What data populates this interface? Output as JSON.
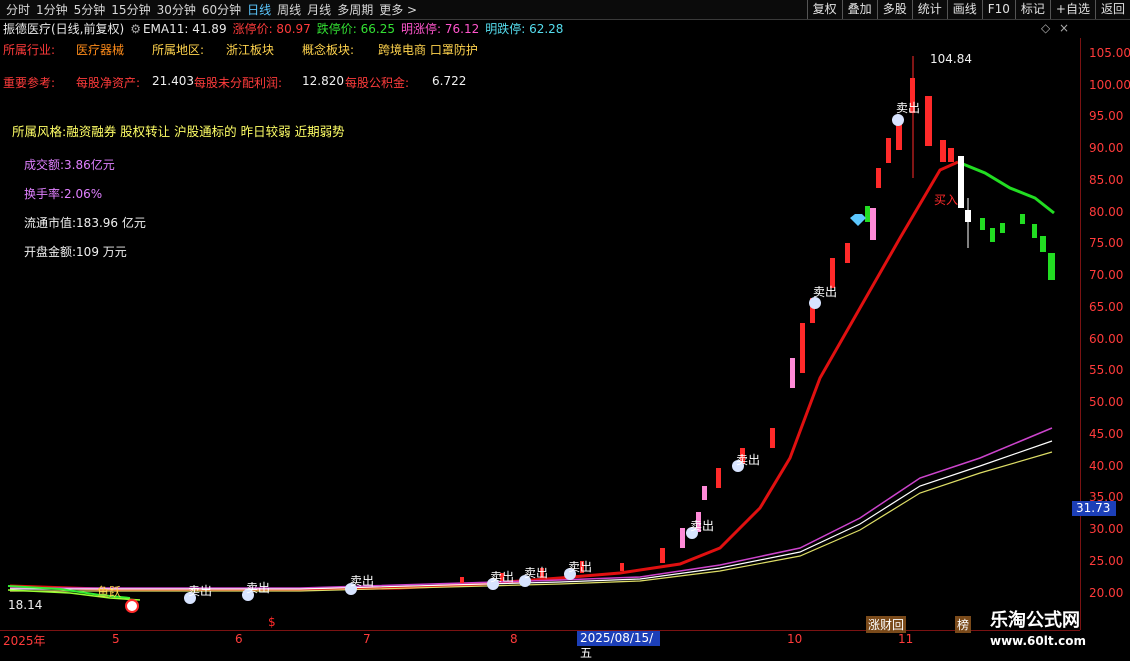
{
  "toolbar": {
    "periods": [
      "分时",
      "1分钟",
      "5分钟",
      "15分钟",
      "30分钟",
      "60分钟",
      "日线",
      "周线",
      "月线",
      "多周期",
      "更多 >"
    ],
    "active_period": "日线",
    "buttons": [
      "复权",
      "叠加",
      "多股",
      "统计",
      "画线",
      "F10",
      "标记",
      "+自选",
      "返回"
    ]
  },
  "infobar": {
    "stock": "振德医疗(日线,前复权)",
    "ema": "EMA11: 41.89",
    "limit_up": "涨停价: 80.97",
    "limit_down": "跌停价: 66.25",
    "next_up": "明涨停: 76.12",
    "next_down": "明跌停: 62.28"
  },
  "info": {
    "industry_label": "所属行业:",
    "industry": "医疗器械",
    "region_label": "所属地区:",
    "region": "浙江板块",
    "concept_label": "概念板块:",
    "concept": "跨境电商 口罩防护",
    "ref_label": "重要参考:",
    "nav_label": "每股净资产:",
    "nav": "21.403",
    "profit_label": "每股未分配利润:",
    "profit": "12.820",
    "fund_label": "每股公积金:",
    "fund": "6.722",
    "style": "所属风格:融资融券 股权转让 沪股通标的 昨日较弱 近期弱势",
    "turnover": "成交额:3.86亿元",
    "rate": "换手率:2.06%",
    "cap": "流通市值:183.96 亿元",
    "open_amount": "开盘金额:109 万元"
  },
  "axis": {
    "y_ticks": [
      "105.00",
      "100.00",
      "95.00",
      "90.00",
      "85.00",
      "80.00",
      "75.00",
      "70.00",
      "65.00",
      "60.00",
      "55.00",
      "50.00",
      "45.00",
      "40.00",
      "35.00",
      "30.00",
      "25.00",
      "20.00"
    ],
    "x_labels": [
      "2025年",
      "5",
      "6",
      "7",
      "8",
      "10",
      "11"
    ],
    "current_price": "31.73",
    "current_date": "2025/08/15/五"
  },
  "annotations": {
    "high": "104.84",
    "low": "18.14",
    "sell": "卖出",
    "buy": "买入",
    "fish": "鱼跃",
    "tag1": "涨财回",
    "tag2": "榜"
  },
  "watermark": {
    "name": "乐淘公式网",
    "url": "www.60lt.com"
  },
  "colors": {
    "up": "#ff2a2a",
    "down": "#22dd22",
    "ema": "#e01010",
    "accent": "#5cc8ff"
  }
}
